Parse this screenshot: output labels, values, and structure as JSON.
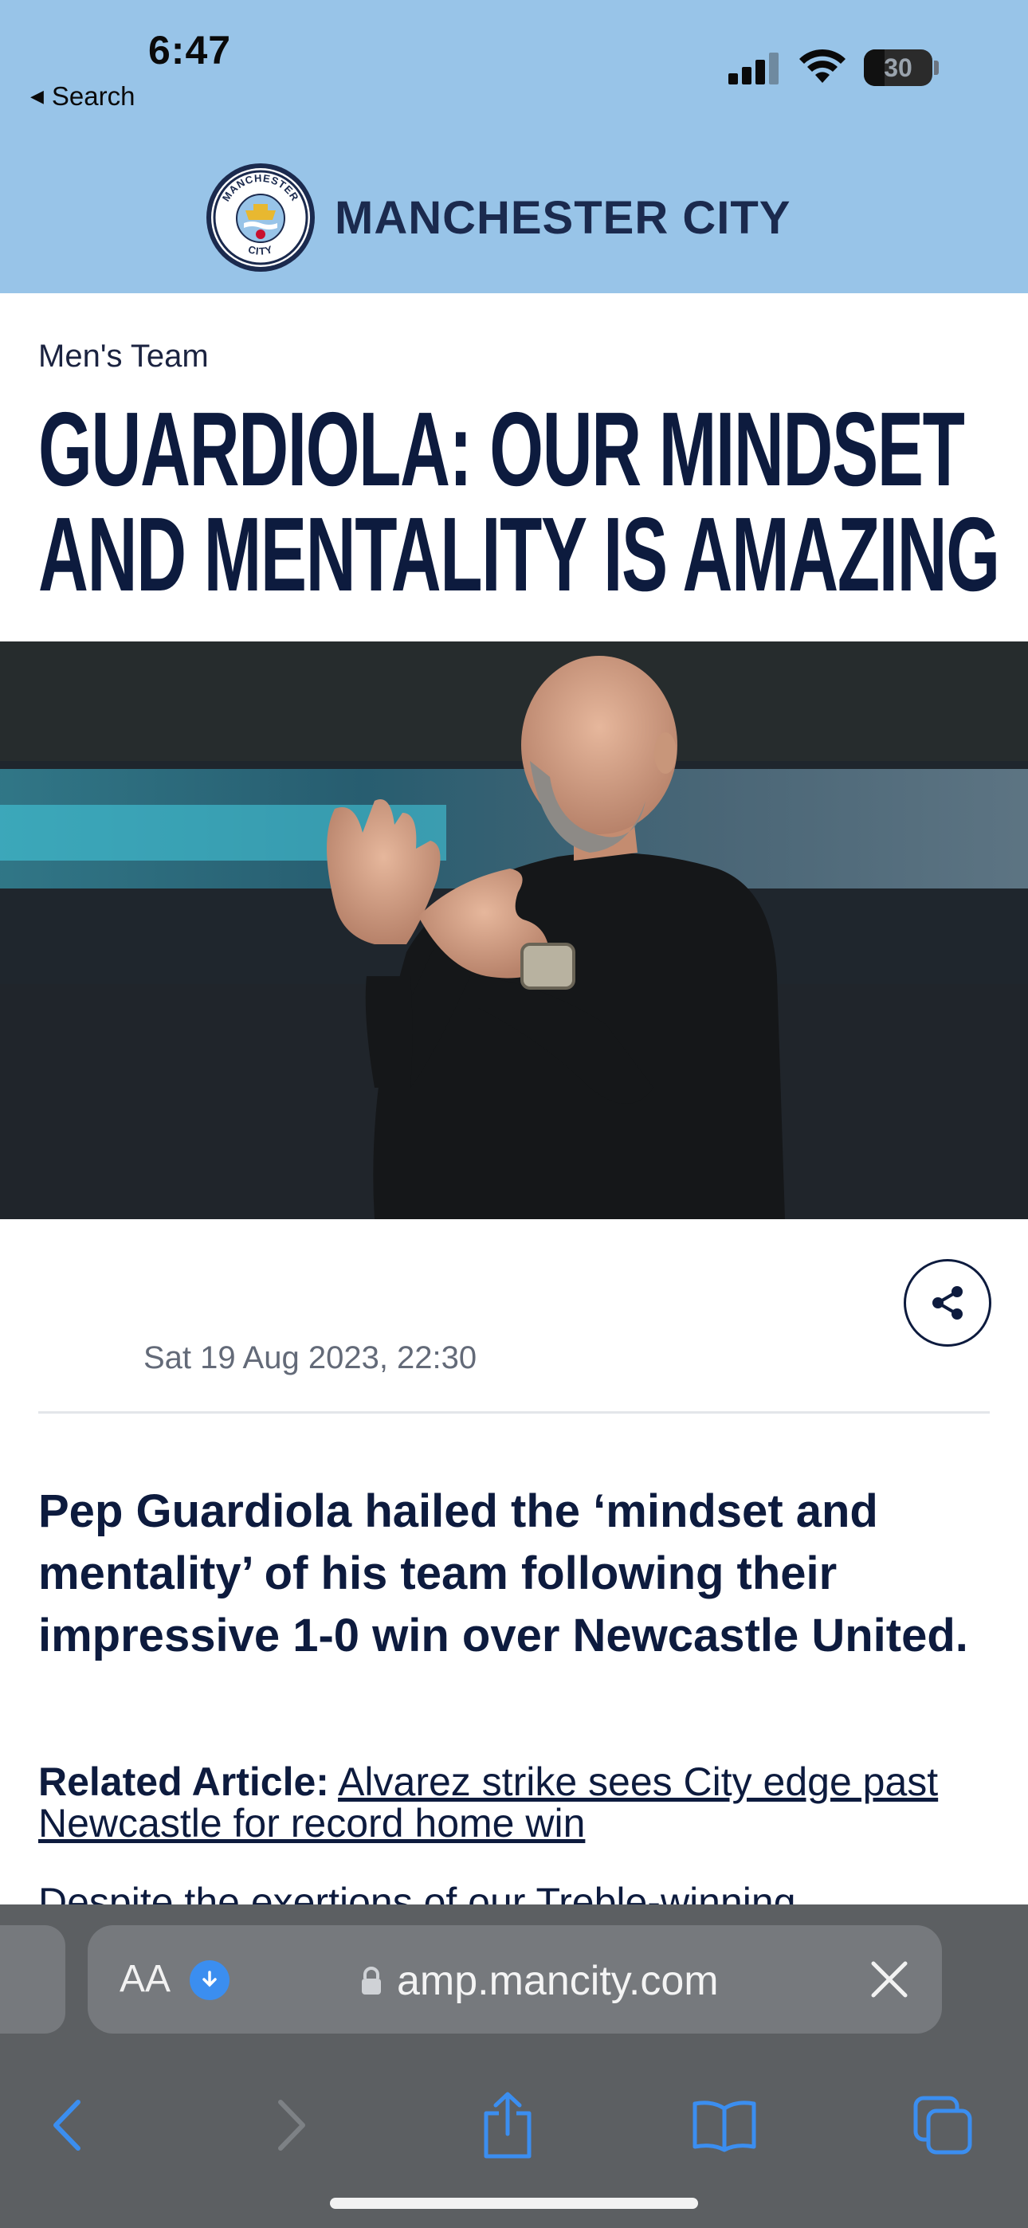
{
  "status_bar": {
    "time": "6:47",
    "back_label": "Search",
    "battery_level": "30"
  },
  "site_header": {
    "brand": "MANCHESTER CITY",
    "crest_top_text": "MANCHESTER",
    "crest_bottom_text": "CITY",
    "background_color": "#98c4e8"
  },
  "article": {
    "category": "Men's Team",
    "headline_lines": [
      "GUARDIOLA: OUR MINDSET",
      "AND MENTALITY IS AMAZING"
    ],
    "date": "Sat 19 Aug 2023, 22:30",
    "lead": "Pep Guardiola hailed the ‘mindset and mentality’ of his team following their impressive 1-0 win over Newcastle United.",
    "related_label": "Related Article:",
    "related_link": "Alvarez strike sees City edge past Newcastle for record home win",
    "next_paragraph_start": "Despite the exertions of our Treble-winning"
  },
  "browser": {
    "aa_label": "AA",
    "url": "amp.mancity.com",
    "icons": [
      "lock-icon",
      "close-icon",
      "back-icon",
      "forward-icon",
      "share-icon",
      "bookmarks-icon",
      "tabs-icon"
    ]
  }
}
